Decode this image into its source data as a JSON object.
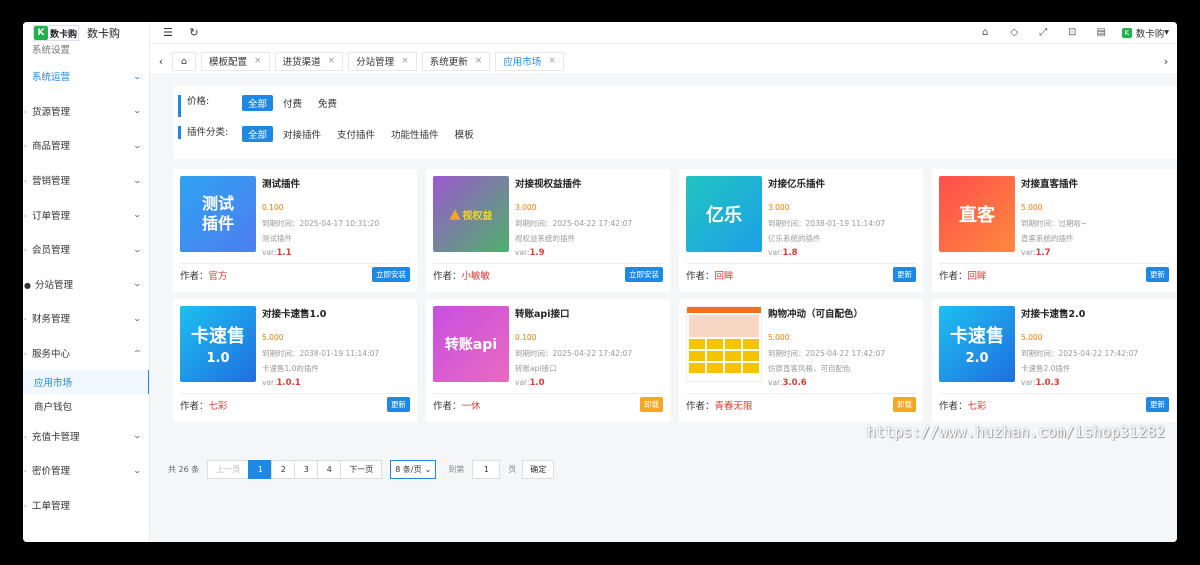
{
  "app": {
    "logo_text": "数卡购",
    "logo_mark": "数卡购"
  },
  "sidebar": {
    "partial_top": "系统设置",
    "items": [
      {
        "label": "系统运营",
        "active": true
      },
      {
        "label": "货源管理"
      },
      {
        "label": "商品管理"
      },
      {
        "label": "营销管理"
      },
      {
        "label": "订单管理"
      },
      {
        "label": "会员管理"
      },
      {
        "label": "分站管理"
      },
      {
        "label": "财务管理"
      },
      {
        "label": "服务中心",
        "expanded": true
      }
    ],
    "sub_items": [
      {
        "label": "应用市场",
        "active": true
      },
      {
        "label": "商户钱包"
      }
    ],
    "items_after": [
      {
        "label": "充值卡管理"
      },
      {
        "label": "密价管理"
      },
      {
        "label": "工单管理"
      }
    ]
  },
  "topbar": {
    "user": "数卡购"
  },
  "tabs": [
    {
      "label": "模板配置"
    },
    {
      "label": "进货渠道"
    },
    {
      "label": "分站管理"
    },
    {
      "label": "系统更新"
    },
    {
      "label": "应用市场",
      "active": true
    }
  ],
  "filters": {
    "price_label": "价格:",
    "price_options": [
      "全部",
      "付费",
      "免费"
    ],
    "category_label": "插件分类:",
    "category_options": [
      "全部",
      "对接插件",
      "支付插件",
      "功能性插件",
      "模板"
    ]
  },
  "cards": [
    {
      "name": "测试插件",
      "thumb_text": "测试插件",
      "price": "0.100",
      "expire": "到期时间：2025-04-17 10:31:20",
      "desc": "测试插件",
      "version": "1.1",
      "author": "官方",
      "action": "立即安装",
      "color": "blue"
    },
    {
      "name": "对接视权益插件",
      "thumb_text": "视权益",
      "price": "3.000",
      "expire": "到期时间：2025-04-22 17:42:07",
      "desc": "视权益系统的插件",
      "version": "1.9",
      "author": "小敏敏",
      "action": "立即安装",
      "color": "blue"
    },
    {
      "name": "对接亿乐插件",
      "thumb_text": "亿乐",
      "price": "3.000",
      "expire": "到期时间：2038-01-19 11:14:07",
      "desc": "亿乐系统的插件",
      "version": "1.8",
      "author": "回眸",
      "action": "更新",
      "color": "blue"
    },
    {
      "name": "对接直客插件",
      "thumb_text": "直客",
      "price": "5.000",
      "expire": "到期时间：过期啦~",
      "desc": "直客系统的插件",
      "version": "1.7",
      "author": "回眸",
      "action": "更新",
      "color": "blue"
    },
    {
      "name": "对接卡速售1.0",
      "thumb_text": "卡速售",
      "thumb_sub": "1.0",
      "price": "5.000",
      "expire": "到期时间：2038-01-19 11:14:07",
      "desc": "卡速售1.0的插件",
      "version": "1.0.1",
      "author": "七彩",
      "action": "更新",
      "color": "blue"
    },
    {
      "name": "转账api接口",
      "thumb_text": "转账api",
      "price": "0.100",
      "expire": "到期时间：2025-04-22 17:42:07",
      "desc": "转账api接口",
      "version": "1.0",
      "author": "一休",
      "action": "卸载",
      "color": "orange"
    },
    {
      "name": "购物冲动（可自配色）",
      "thumb_text": "",
      "price": "5.000",
      "expire": "到期时间：2025-04-22 17:42:07",
      "desc": "仿原直客风格，可自配色",
      "version": "3.0.6",
      "author": "青春无限",
      "action": "卸载",
      "color": "orange"
    },
    {
      "name": "对接卡速售2.0",
      "thumb_text": "卡速售",
      "thumb_sub": "2.0",
      "price": "5.000",
      "expire": "到期时间：2025-04-22 17:42:07",
      "desc": "卡速售2.0插件",
      "version": "1.0.3",
      "author": "七彩",
      "action": "更新",
      "color": "blue"
    }
  ],
  "labels": {
    "author": "作者：",
    "version_prefix": "var:"
  },
  "pagination": {
    "total": "共 26 条",
    "prev": "上一页",
    "pages": [
      "1",
      "2",
      "3",
      "4"
    ],
    "current": "1",
    "next": "下一页",
    "page_size": "8 条/页",
    "goto_label": "到第",
    "goto_value": "1",
    "page_unit": "页",
    "confirm": "确定"
  },
  "watermark": "https://www.huzhan.com/ishop31282"
}
